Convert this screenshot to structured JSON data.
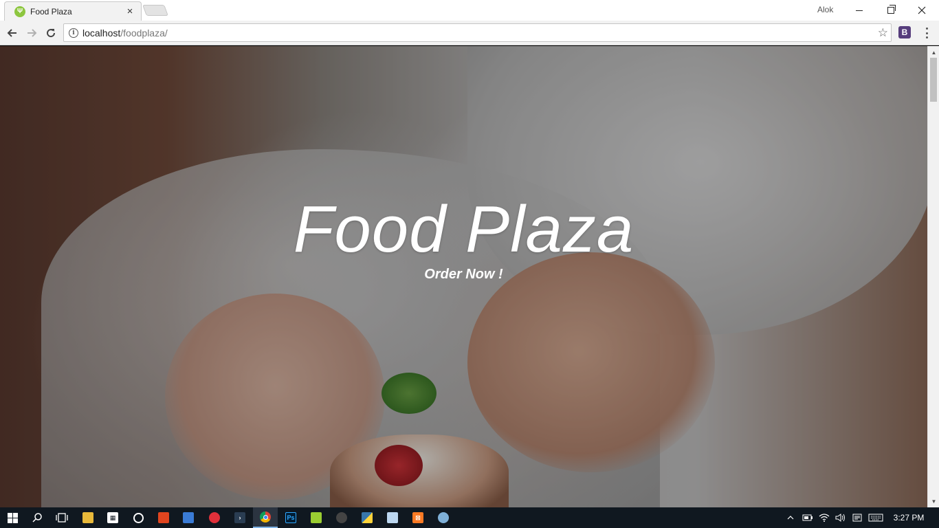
{
  "browser": {
    "tab_title": "Food Plaza",
    "tab_close": "×",
    "profile_name": "Alok",
    "url_host": "localhost",
    "url_path": "/foodplaza/",
    "extension_label": "B"
  },
  "hero": {
    "title": "Food Plaza",
    "cta": "Order Now !"
  },
  "taskbar": {
    "clock": "3:27 PM",
    "apps": [
      "file-explorer",
      "store",
      "groove",
      "office",
      "remote-desktop",
      "target-app",
      "terminal-app",
      "chrome",
      "photoshop",
      "notepad",
      "obs",
      "python",
      "notes",
      "xampp",
      "paint"
    ]
  },
  "colors": {
    "titlebar": "#ffffff",
    "toolbar": "#f2f2f2",
    "taskbar": "#101820",
    "favicon": "#8dc63f",
    "extension": "#563d7c"
  }
}
